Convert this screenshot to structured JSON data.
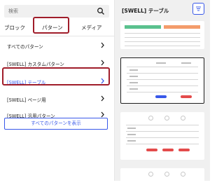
{
  "search": {
    "placeholder": "検索"
  },
  "tabs": [
    {
      "label": "ブロック"
    },
    {
      "label": "パターン",
      "active": true
    },
    {
      "label": "メディア"
    }
  ],
  "categories": [
    {
      "label": "すべてのパターン"
    },
    {
      "label": "[SWELL] カスタムパターン"
    },
    {
      "label": "[SWELL] テーブル",
      "selected": true
    },
    {
      "label": "[SWELL] ページ用"
    },
    {
      "label": "[SWELL] 汎用パターン"
    }
  ],
  "show_all_label": "すべてのパターンを表示",
  "preview": {
    "title": "[SWELL] テーブル"
  },
  "colors": {
    "accent": "#3858e9",
    "highlight": "#a01d2a",
    "table_green": "#5ac18e",
    "table_orange": "#f39c6b",
    "table_red": "#e34b4b"
  },
  "icons": {
    "search": "search-icon",
    "filter": "filter-icon",
    "chevron": "chevron-right-icon"
  }
}
